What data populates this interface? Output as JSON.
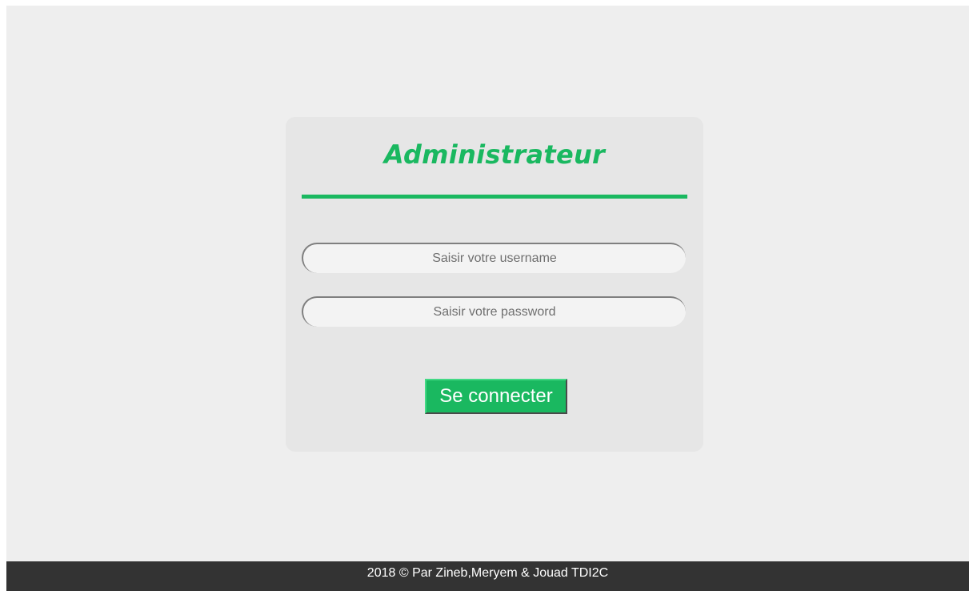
{
  "login_card": {
    "title": "Administrateur",
    "username_placeholder": "Saisir votre username",
    "password_placeholder": "Saisir votre password",
    "submit_label": "Se connecter"
  },
  "footer": {
    "text": "2018 © Par Zineb,Meryem & Jouad TDI2C"
  },
  "colors": {
    "accent": "#1ab860",
    "page_background": "#eeeeee",
    "card_background": "#e6e6e6",
    "footer_background": "#333333"
  }
}
